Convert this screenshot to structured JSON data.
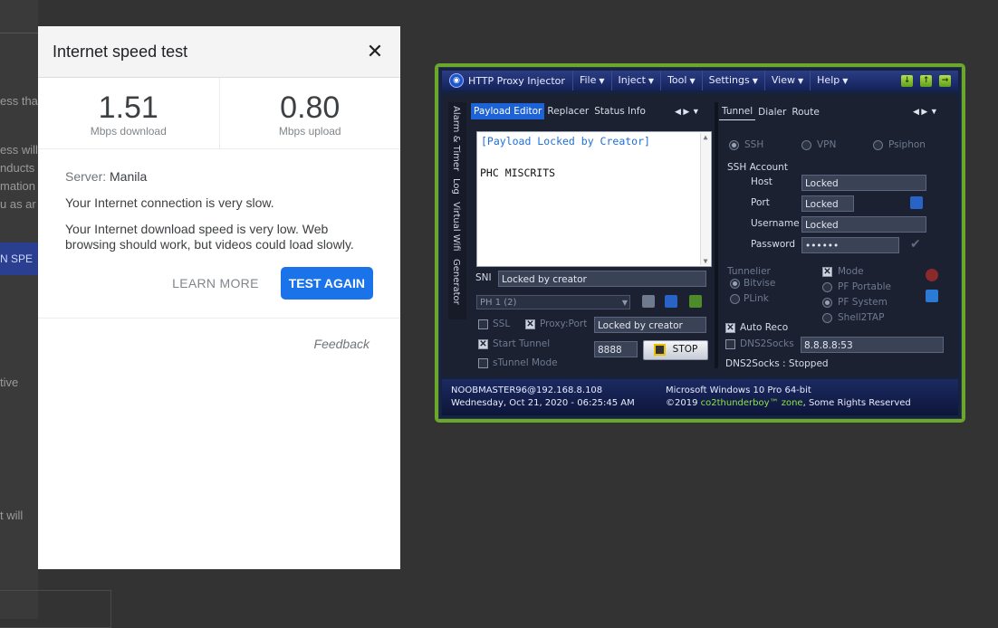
{
  "background_page": {
    "fragments": [
      "ess tha",
      "ess will",
      "nducts",
      "mation",
      "u as ar",
      "N SPE",
      "tive",
      "t will"
    ]
  },
  "speed_test": {
    "title": "Internet speed test",
    "download": {
      "value": "1.51",
      "unit": "Mbps download"
    },
    "upload": {
      "value": "0.80",
      "unit": "Mbps upload"
    },
    "server_label": "Server:",
    "server_name": "Manila",
    "message_1": "Your Internet connection is very slow.",
    "message_2": "Your Internet download speed is very low. Web browsing should work, but videos could load slowly.",
    "learn_more": "LEARN MORE",
    "test_again": "TEST AGAIN",
    "feedback": "Feedback",
    "close_glyph": "✕"
  },
  "hpi": {
    "title": "HTTP Proxy Injector",
    "menu": [
      "File",
      "Inject",
      "Tool",
      "Settings",
      "View",
      "Help"
    ],
    "vertical_tabs": [
      "Alarm & Timer",
      "Log",
      "Virtual Wifi",
      "Generator"
    ],
    "left_tabs": [
      "Payload Editor",
      "Replacer",
      "Status Info"
    ],
    "right_tabs": [
      "Tunnel",
      "Dialer",
      "Route"
    ],
    "payload_line_1": "[Payload Locked by Creator]",
    "payload_line_2": "PHC MISCRITS",
    "sni_label": "SNI",
    "sni_value": "Locked by creator",
    "profile_select": "PH 1 (2)",
    "ssl_label": "SSL",
    "proxy_port_label": "Proxy:Port",
    "proxy_value": "Locked by creator",
    "start_tunnel_label": "Start Tunnel",
    "port_value": "8888",
    "stop_button": "STOP",
    "stunnel_label": "sTunnel Mode",
    "mode_ssh": "SSH",
    "mode_vpn": "VPN",
    "mode_psiphon": "Psiphon",
    "ssh_account_label": "SSH Account",
    "host_label": "Host",
    "host_value": "Locked",
    "port_label": "Port",
    "port_field_value": "Locked",
    "username_label": "Username",
    "username_value": "Locked",
    "password_label": "Password",
    "password_value": "••••••",
    "tunnelier_label": "Tunnelier",
    "bitvise_label": "Bitvise",
    "plink_label": "PLink",
    "mode_label": "Mode",
    "pf_portable": "PF Portable",
    "pf_system": "PF System",
    "shell2tap": "Shell2TAP",
    "auto_reco": "Auto Reco",
    "dns2socks_label": "DNS2Socks",
    "dns_value": "8.8.8.8:53",
    "dns_status": "DNS2Socks : Stopped",
    "footer_user": "NOOBMASTER96@192.168.8.108",
    "footer_datetime": "Wednesday, Oct 21, 2020 - 06:25:45 AM",
    "footer_os": "Microsoft Windows 10 Pro 64-bit",
    "footer_copy_prefix": "©2019",
    "footer_brand": "co2thunderboy™ zone",
    "footer_copy_suffix": ", Some Rights Reserved",
    "colors": {
      "frame": "#6aa72a",
      "active_tab": "#1e63d6",
      "brand": "#8ee24a"
    }
  }
}
